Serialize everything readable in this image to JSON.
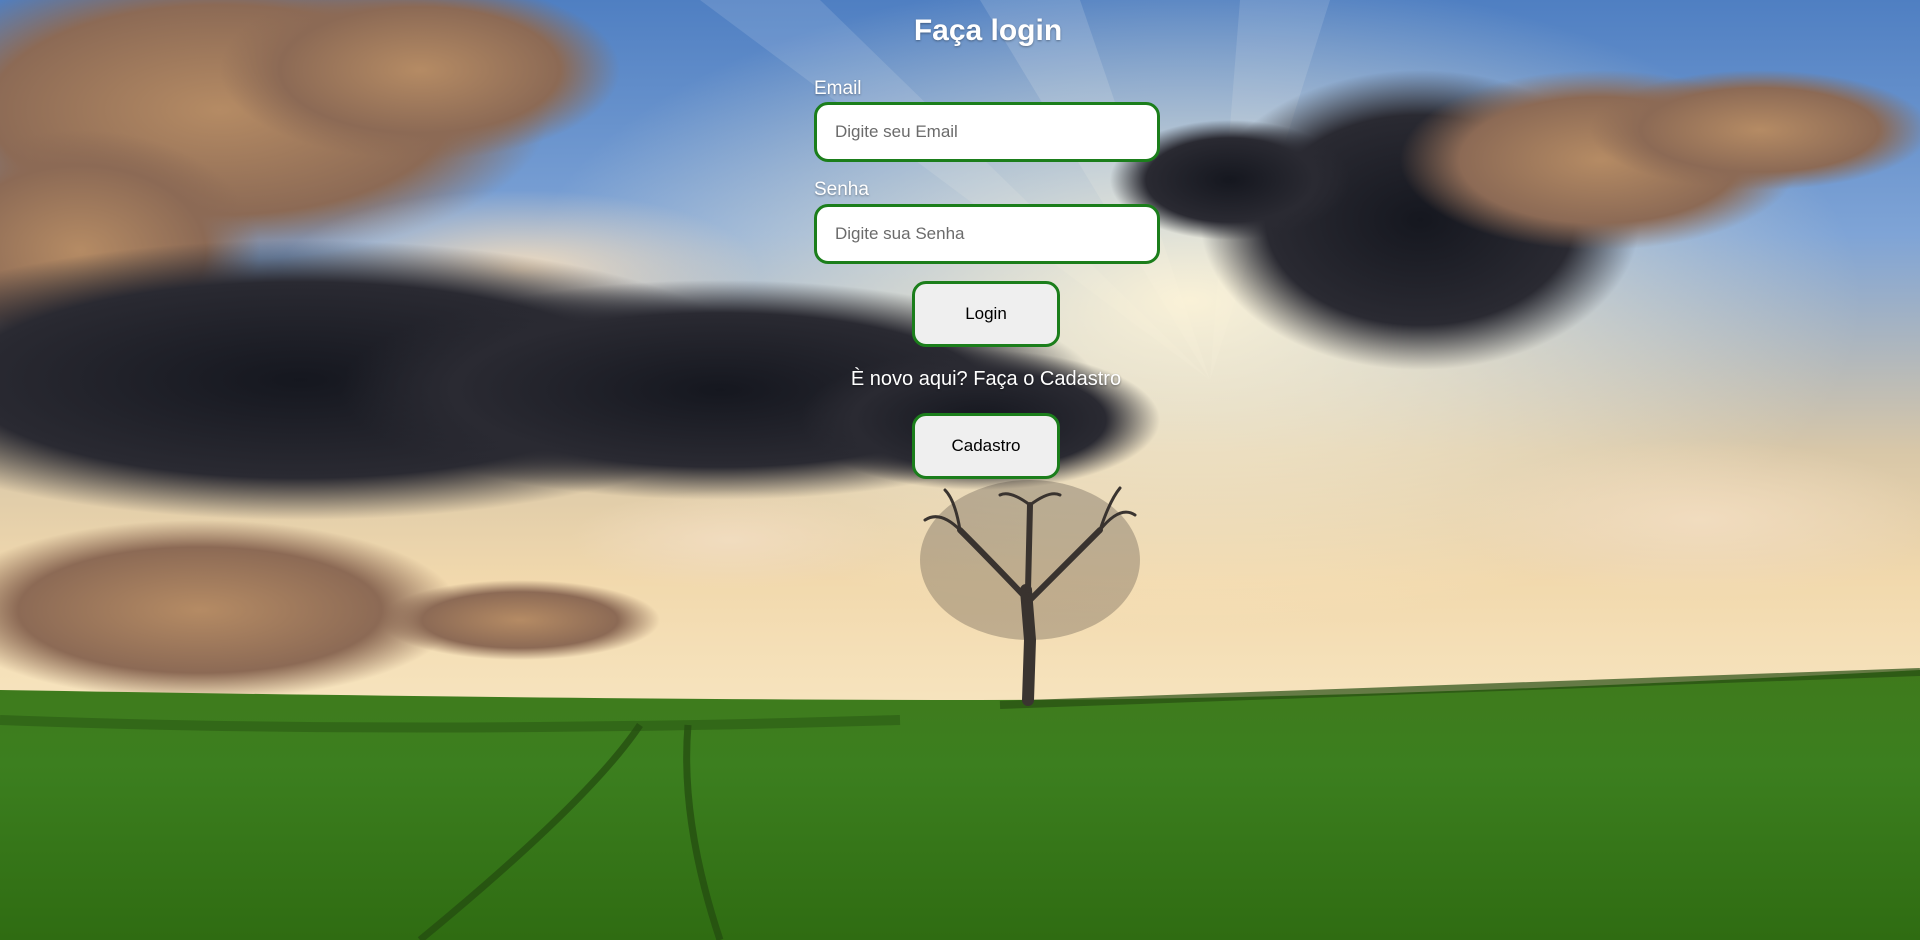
{
  "page": {
    "title": "Faça login"
  },
  "form": {
    "email_label": "Email",
    "email_placeholder": "Digite seu Email",
    "email_value": "",
    "password_label": "Senha",
    "password_placeholder": "Digite sua Senha",
    "password_value": "",
    "login_button": "Login",
    "signup_prompt": "È novo aqui? Faça o Cadastro",
    "signup_button": "Cadastro"
  },
  "colors": {
    "field_border": "#1b7e1b",
    "button_bg": "#efefef",
    "text_light": "#ffffff"
  }
}
